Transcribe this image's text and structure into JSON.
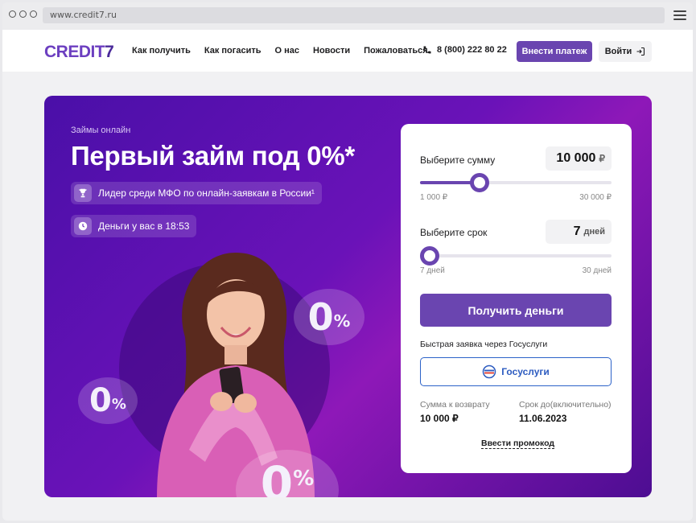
{
  "browser": {
    "url": "www.credit7.ru"
  },
  "header": {
    "logo_main": "CREDIT",
    "logo_seven": "7",
    "nav": [
      "Как получить",
      "Как погасить",
      "О нас",
      "Новости",
      "Пожаловаться"
    ],
    "phone": "8 (800) 222 80 22",
    "pay_label": "Внести платеж",
    "login_label": "Войти"
  },
  "hero": {
    "subtitle": "Займы онлайн",
    "title": "Первый займ под 0%*",
    "badge_leader": "Лидер среди МФО по онлайн-заявкам в России¹",
    "badge_time": "Деньги у вас в 18:53",
    "zero_sign": "0",
    "percent_sign": "%"
  },
  "calculator": {
    "amount_label": "Выберите сумму",
    "amount_value": "10 000",
    "amount_currency": "₽",
    "amount_min": "1 000 ₽",
    "amount_max": "30 000 ₽",
    "amount_fraction": 0.31,
    "term_label": "Выберите срок",
    "term_value": "7",
    "term_unit": "дней",
    "term_min": "7 дней",
    "term_max": "30 дней",
    "term_fraction": 0.0,
    "submit_label": "Получить деньги",
    "gosuslugi_caption": "Быстрая заявка через Госуслуги",
    "gosuslugi_label": "Госуслуги",
    "return_label": "Сумма к возврату",
    "return_value": "10 000 ₽",
    "due_label": "Срок до(включительно)",
    "due_value": "11.06.2023",
    "promo_label": "Ввести промокод"
  },
  "colors": {
    "brand": "#6a45b0",
    "hero_dark": "#4a0fa8",
    "gosuslugi": "#2c62c8"
  }
}
